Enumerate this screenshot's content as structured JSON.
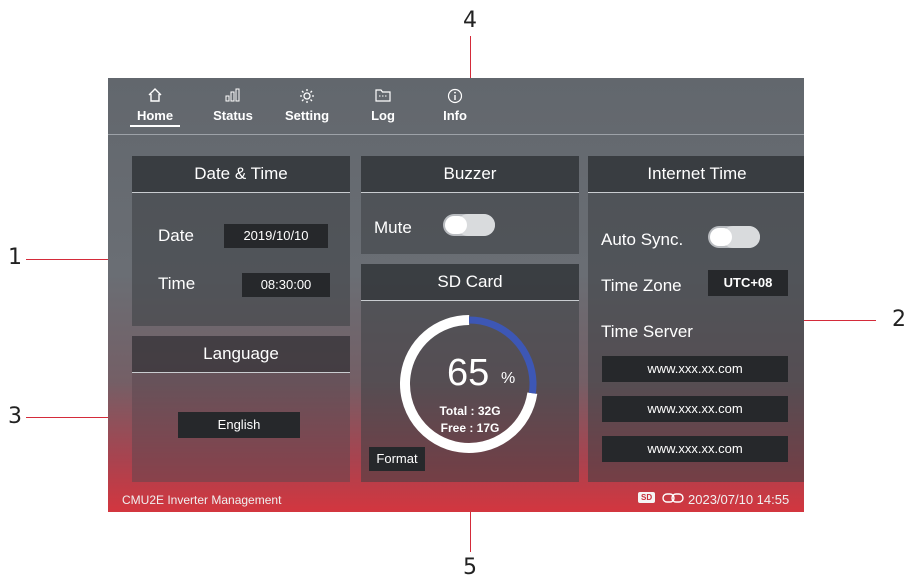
{
  "callouts": [
    "1",
    "2",
    "3",
    "4",
    "5"
  ],
  "nav": {
    "items": [
      {
        "label": "Home",
        "icon": "home-icon"
      },
      {
        "label": "Status",
        "icon": "bar-chart-icon"
      },
      {
        "label": "Setting",
        "icon": "gear-icon"
      },
      {
        "label": "Log",
        "icon": "folder-icon"
      },
      {
        "label": "Info",
        "icon": "info-icon"
      }
    ]
  },
  "datetime": {
    "title": "Date & Time",
    "date_label": "Date",
    "date_value": "2019/10/10",
    "time_label": "Time",
    "time_value": "08:30:00"
  },
  "language": {
    "title": "Language",
    "value": "English"
  },
  "buzzer": {
    "title": "Buzzer",
    "mute_label": "Mute",
    "mute_on": true
  },
  "sdcard": {
    "title": "SD Card",
    "percent": "65",
    "percent_unit": "%",
    "usage_fraction": 0.65,
    "total": "Total : 32G",
    "free": "Free : 17G",
    "format_button": "Format"
  },
  "internet_time": {
    "title": "Internet Time",
    "auto_sync_label": "Auto Sync.",
    "auto_sync_on": true,
    "timezone_label": "Time Zone",
    "timezone_value": "UTC+08",
    "server_label": "Time Server",
    "servers": [
      "www.xxx.xx.com",
      "www.xxx.xx.com",
      "www.xxx.xx.com"
    ]
  },
  "footer": {
    "app_name": "CMU2E Inverter Management",
    "sd_badge": "SD",
    "datetime": "2023/07/10 14:55"
  },
  "colors": {
    "accent_red": "#d42b3a",
    "ring_used": "#3d57b5",
    "ring_free": "#ffffff"
  }
}
